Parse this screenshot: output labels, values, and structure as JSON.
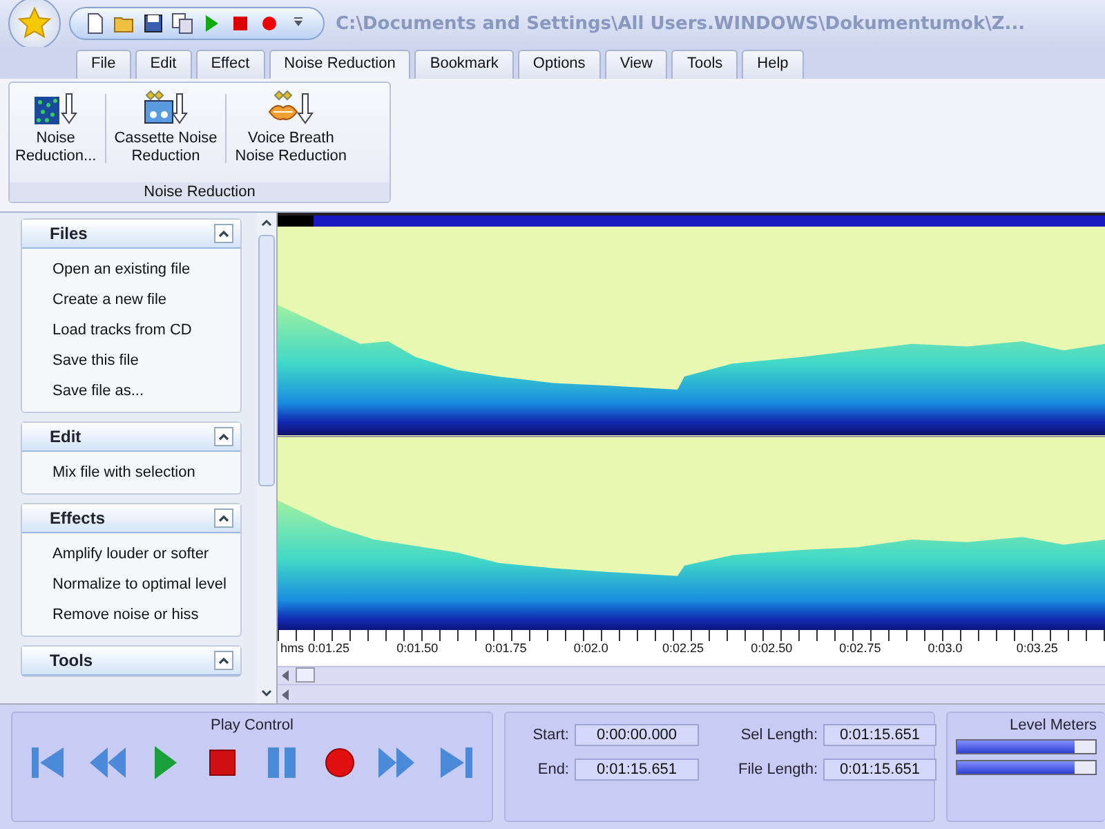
{
  "window": {
    "title": "C:\\Documents and Settings\\All Users.WINDOWS\\Dokumentumok\\Z..."
  },
  "tabs": [
    {
      "label": "File",
      "selected": false
    },
    {
      "label": "Edit",
      "selected": false
    },
    {
      "label": "Effect",
      "selected": false
    },
    {
      "label": "Noise Reduction",
      "selected": true
    },
    {
      "label": "Bookmark",
      "selected": false
    },
    {
      "label": "Options",
      "selected": false
    },
    {
      "label": "View",
      "selected": false
    },
    {
      "label": "Tools",
      "selected": false
    },
    {
      "label": "Help",
      "selected": false
    }
  ],
  "ribbon": {
    "group": "Noise Reduction",
    "buttons": [
      {
        "kind": "noise",
        "label": "Noise\nReduction..."
      },
      {
        "kind": "cassette",
        "label": "Cassette Noise\nReduction"
      },
      {
        "kind": "voice",
        "label": "Voice Breath\nNoise Reduction"
      }
    ]
  },
  "task_panels": [
    {
      "title": "Files",
      "expanded": true,
      "items": [
        "Open an existing file",
        "Create a new file",
        "Load tracks from CD",
        "Save this file",
        "Save file as..."
      ]
    },
    {
      "title": "Edit",
      "expanded": true,
      "items": [
        "Mix file with selection"
      ]
    },
    {
      "title": "Effects",
      "expanded": true,
      "items": [
        "Amplify louder or softer",
        "Normalize to optimal level",
        "Remove noise or hiss"
      ]
    },
    {
      "title": "Tools",
      "expanded": true
    }
  ],
  "timeline": {
    "unit": "hms",
    "ticks": [
      "0:01.25",
      "0:01.50",
      "0:01.75",
      "0:02.0",
      "0:02.25",
      "0:02.50",
      "0:02.75",
      "0:03.0",
      "0:03.25"
    ]
  },
  "play_control": {
    "title": "Play Control",
    "buttons": [
      {
        "kind": "first"
      },
      {
        "kind": "rewind"
      },
      {
        "kind": "play"
      },
      {
        "kind": "stop"
      },
      {
        "kind": "pause"
      },
      {
        "kind": "record"
      },
      {
        "kind": "forward"
      },
      {
        "kind": "last"
      }
    ]
  },
  "selection": {
    "fields": [
      {
        "label": "Start:",
        "value": "0:00:00.000"
      },
      {
        "label": "Sel Length:",
        "value": "0:01:15.651"
      },
      {
        "label": "End:",
        "value": "0:01:15.651"
      },
      {
        "label": "File Length:",
        "value": "0:01:15.651"
      }
    ]
  },
  "level_meters": {
    "title": "Level Meters",
    "meters": [
      {
        "level": 0.85
      },
      {
        "level": 0.85
      }
    ]
  }
}
